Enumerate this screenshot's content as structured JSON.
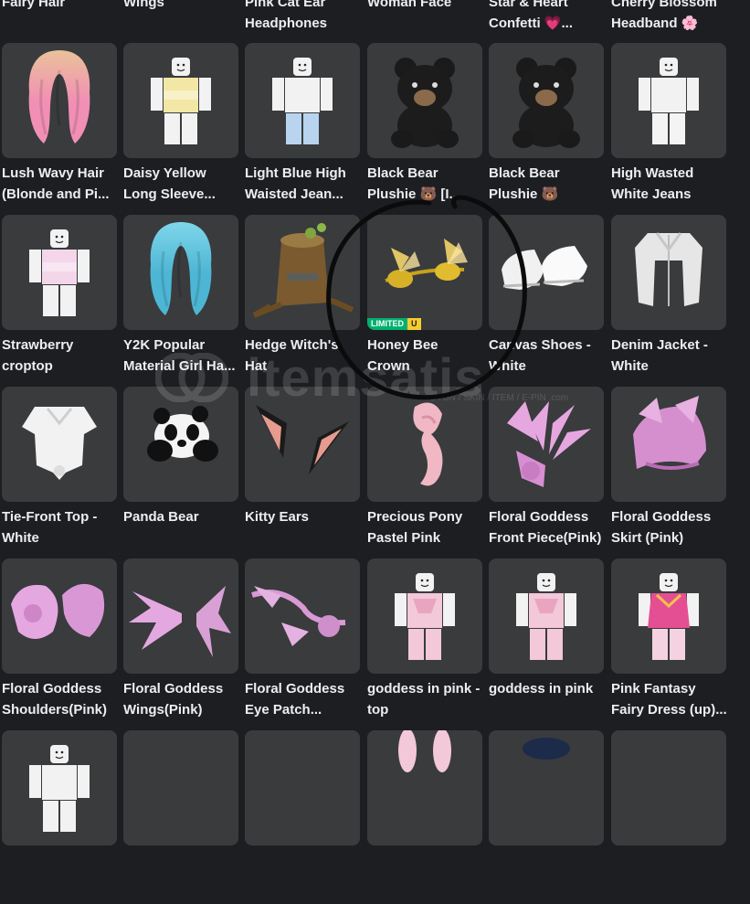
{
  "items": [
    {
      "name": "Fairy Hair",
      "icon": "hair-icon"
    },
    {
      "name": "Wings",
      "icon": "wings-icon"
    },
    {
      "name": "Pink Cat Ear Headphones",
      "icon": "headphones-icon"
    },
    {
      "name": "Woman Face",
      "icon": "face-icon"
    },
    {
      "name": "Star & Heart Confetti 💗...",
      "icon": "confetti-icon"
    },
    {
      "name": "Cherry Blossom Headband 🌸",
      "icon": "headband-icon"
    },
    {
      "name": "Lush Wavy Hair (Blonde and Pi...",
      "icon": "hair-icon",
      "colors": [
        "#e9c29a",
        "#f28fb4"
      ]
    },
    {
      "name": "Daisy Yellow Long Sleeve...",
      "icon": "avatar-shirt-icon",
      "colors": [
        "#f2e7a4"
      ]
    },
    {
      "name": "Light Blue High Waisted Jean...",
      "icon": "avatar-jeans-icon",
      "colors": [
        "#b8d4ee"
      ]
    },
    {
      "name": "Black Bear Plushie 🐻 [I...",
      "icon": "bear-plushie-icon"
    },
    {
      "name": "Black Bear Plushie 🐻",
      "icon": "bear-plushie-icon"
    },
    {
      "name": "High Wasted White Jeans",
      "icon": "avatar-jeans-icon",
      "colors": [
        "#f4f4f4"
      ]
    },
    {
      "name": "Strawberry croptop",
      "icon": "avatar-shirt-icon",
      "colors": [
        "#f4d6ea"
      ]
    },
    {
      "name": "Y2K Popular Material Girl Ha...",
      "icon": "hair-icon",
      "colors": [
        "#7fd6ea",
        "#4db6d4"
      ]
    },
    {
      "name": "Hedge Witch's Hat",
      "icon": "stump-hat-icon"
    },
    {
      "name": "Honey Bee Crown",
      "icon": "bee-crown-icon",
      "limited": {
        "label": "LIMITED",
        "u": "U"
      }
    },
    {
      "name": "Canvas Shoes - White",
      "icon": "shoes-icon"
    },
    {
      "name": "Denim Jacket - White",
      "icon": "jacket-icon"
    },
    {
      "name": "Tie-Front Top - White",
      "icon": "tie-top-icon"
    },
    {
      "name": "Panda Bear",
      "icon": "panda-icon"
    },
    {
      "name": "Kitty Ears",
      "icon": "cat-ears-icon"
    },
    {
      "name": "Precious Pony Pastel Pink",
      "icon": "ponytail-icon"
    },
    {
      "name": "Floral Goddess Front Piece(Pink)",
      "icon": "floral-front-icon"
    },
    {
      "name": "Floral Goddess Skirt (Pink)",
      "icon": "floral-skirt-icon"
    },
    {
      "name": "Floral Goddess Shoulders(Pink)",
      "icon": "floral-shoulders-icon"
    },
    {
      "name": "Floral Goddess Wings(Pink)",
      "icon": "floral-wings-icon"
    },
    {
      "name": "Floral Goddess Eye Patch...",
      "icon": "eye-patch-icon"
    },
    {
      "name": "goddess in pink - top",
      "icon": "avatar-dress-icon",
      "colors": [
        "#f3c8d8"
      ]
    },
    {
      "name": "goddess in pink",
      "icon": "avatar-dress-icon",
      "colors": [
        "#f3c8d8"
      ]
    },
    {
      "name": "Pink Fantasy Fairy Dress (up)...",
      "icon": "avatar-fantasy-dress-icon",
      "colors": [
        "#ef6aa8"
      ]
    },
    {
      "name": "",
      "icon": "avatar-icon"
    },
    {
      "name": "",
      "icon": "unknown-icon"
    },
    {
      "name": "",
      "icon": "unknown-icon"
    },
    {
      "name": "",
      "icon": "bunny-ears-icon"
    },
    {
      "name": "",
      "icon": "hat-icon"
    },
    {
      "name": "",
      "icon": "unknown-icon"
    }
  ],
  "watermark": {
    "text": "itemsatis",
    "subtext": "OYUN / SKIN / ITEM / E-PIN .com"
  },
  "colors": {
    "background": "#1d1e21",
    "card": "#393b3d",
    "text": "#eceef0",
    "limited": "#00b06f",
    "unique": "#f5cd30"
  }
}
